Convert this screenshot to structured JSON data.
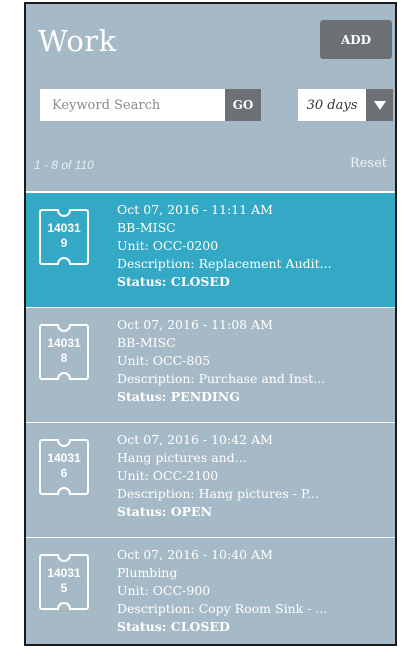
{
  "header": {
    "title": "Work",
    "add_label": "ADD"
  },
  "search": {
    "placeholder": "Keyword Search",
    "go_label": "GO",
    "range_label": "30 days"
  },
  "meta": {
    "count_text": "1 - 8 of 110",
    "reset_label": "Reset"
  },
  "colors": {
    "panel": "#a6b9c6",
    "selected": "#33a9c5",
    "button": "#6d7075"
  },
  "items": [
    {
      "ticket_line1": "14031",
      "ticket_line2": "9",
      "datetime": "Oct 07, 2016 - 11:11 AM",
      "title": "BB-MISC",
      "unit": "Unit: OCC-0200",
      "description": "Description: Replacement Audit...",
      "status": "Status: CLOSED",
      "selected": true
    },
    {
      "ticket_line1": "14031",
      "ticket_line2": "8",
      "datetime": "Oct 07, 2016 - 11:08 AM",
      "title": "BB-MISC",
      "unit": "Unit: OCC-805",
      "description": "Description: Purchase and Inst...",
      "status": "Status: PENDING",
      "selected": false
    },
    {
      "ticket_line1": "14031",
      "ticket_line2": "6",
      "datetime": "Oct 07, 2016 - 10:42 AM",
      "title": "Hang pictures and...",
      "unit": "Unit: OCC-2100",
      "description": "Description: Hang pictures - P...",
      "status": "Status: OPEN",
      "selected": false
    },
    {
      "ticket_line1": "14031",
      "ticket_line2": "5",
      "datetime": "Oct 07, 2016 - 10:40 AM",
      "title": "Plumbing",
      "unit": "Unit: OCC-900",
      "description": "Description: Copy Room Sink - ...",
      "status": "Status: CLOSED",
      "selected": false
    }
  ]
}
